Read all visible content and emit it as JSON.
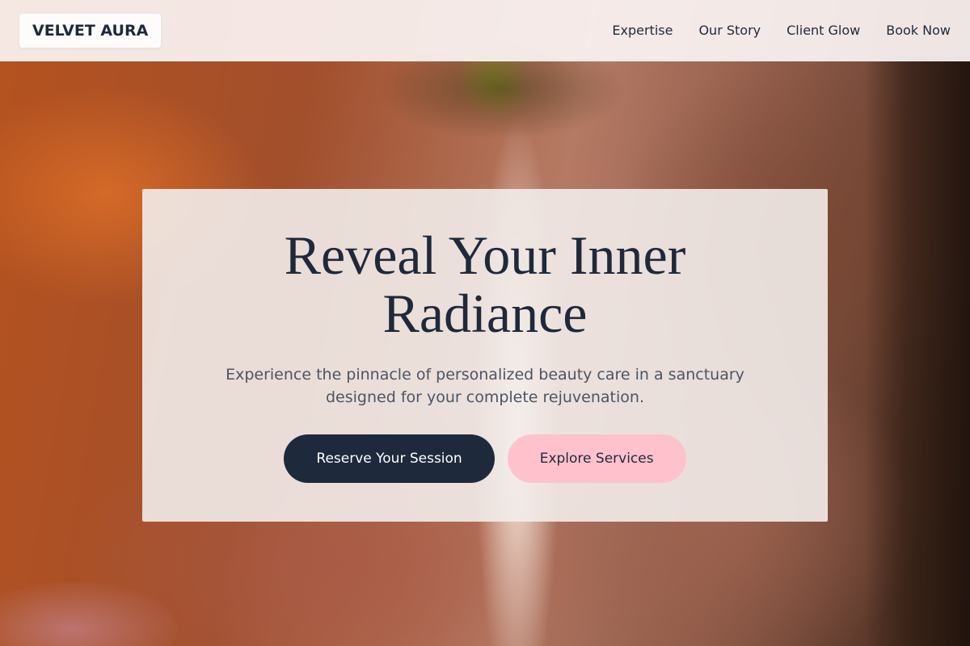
{
  "brand": {
    "name": "VELVET AURA"
  },
  "nav": {
    "items": [
      {
        "label": "Expertise"
      },
      {
        "label": "Our Story"
      },
      {
        "label": "Client Glow"
      },
      {
        "label": "Book Now"
      }
    ]
  },
  "hero": {
    "title": "Reveal Your Inner Radiance",
    "subtitle": "Experience the pinnacle of personalized beauty care in a sanctuary designed for your complete rejuvenation.",
    "primary_button": "Reserve Your Session",
    "secondary_button": "Explore Services"
  },
  "colors": {
    "primary": "#1e293b",
    "accent_pink": "#ffc2cc",
    "text_muted": "#4b5563"
  }
}
